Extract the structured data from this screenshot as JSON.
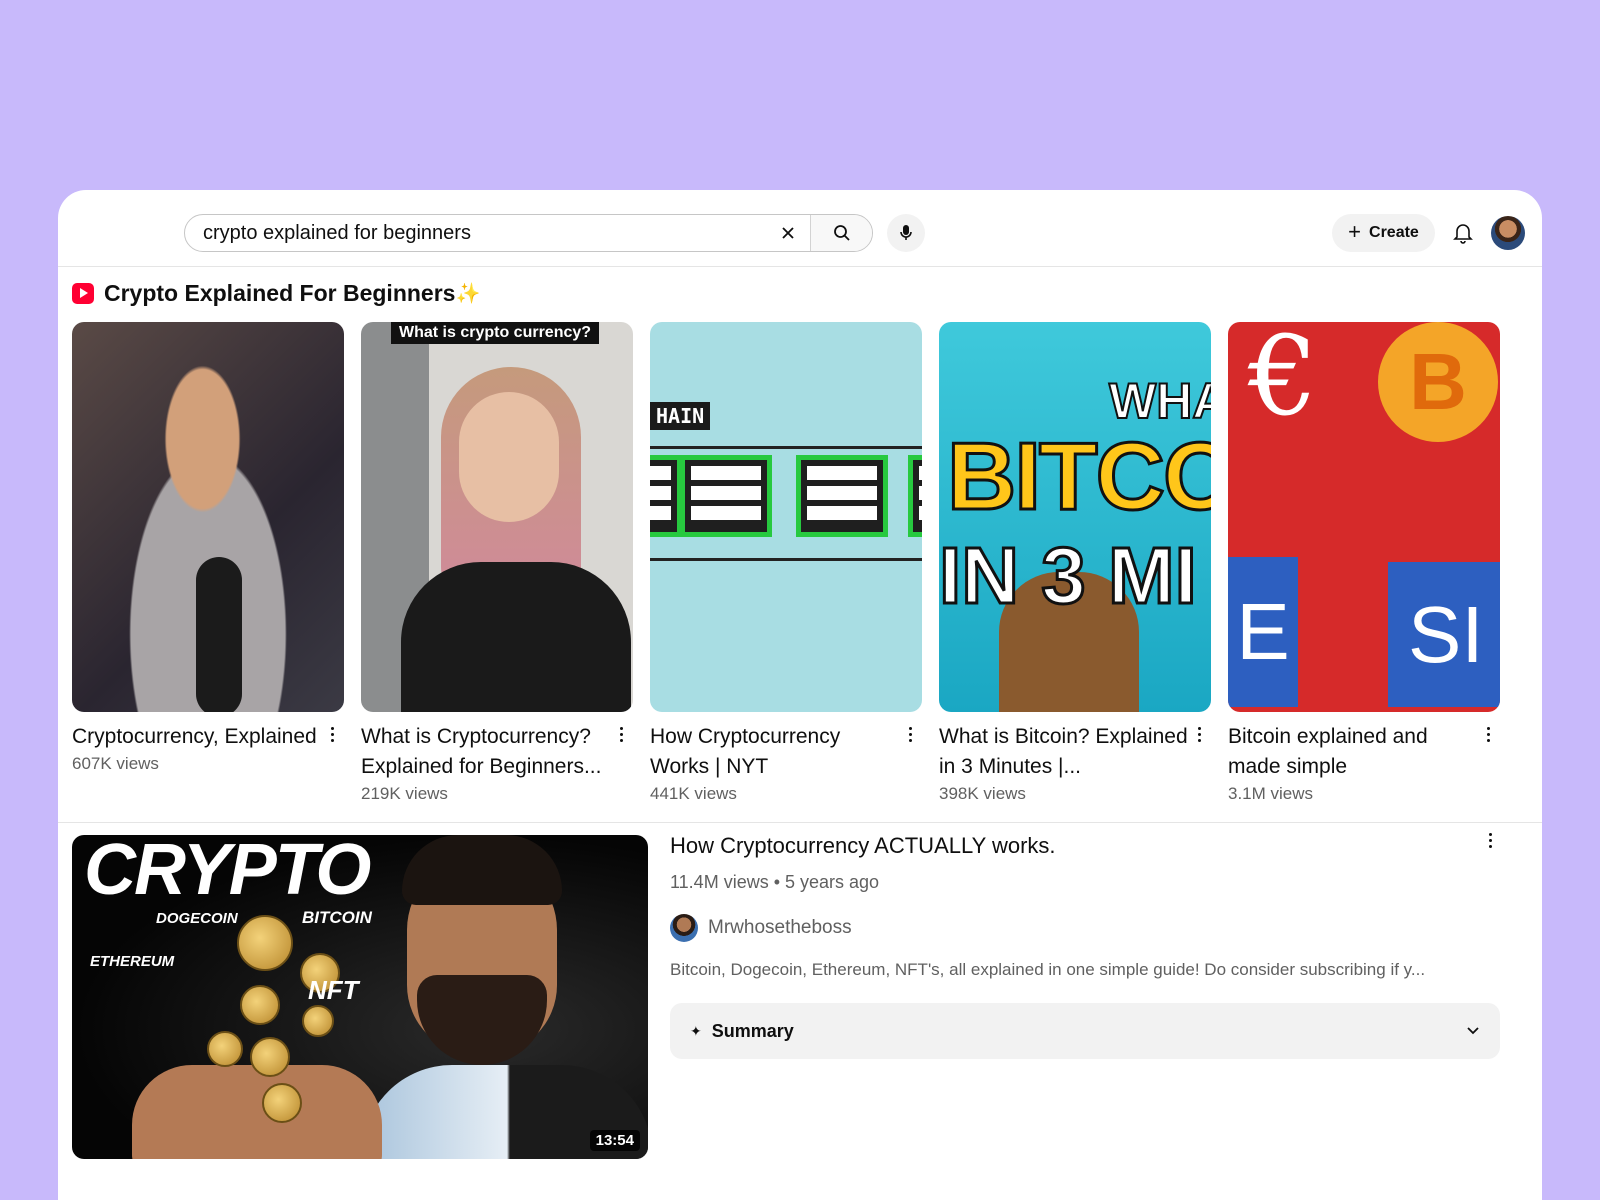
{
  "search": {
    "query": "crypto explained for beginners"
  },
  "header": {
    "create_label": "Create"
  },
  "shelf": {
    "title": "Crypto Explained For Beginners",
    "title_emoji": "✨",
    "items": [
      {
        "title": "Cryptocurrency, Explained",
        "views": "607K views"
      },
      {
        "title": "What is Cryptocurrency? Explained for Beginners...",
        "views": "219K views",
        "caption": "What is crypto currency?"
      },
      {
        "title": "How Cryptocurrency Works | NYT",
        "views": "441K views",
        "label": "HAIN"
      },
      {
        "title": "What is Bitcoin? Explained in 3 Minutes |...",
        "views": "398K views",
        "words": [
          "WHAT",
          "BITCO",
          "IN 3 MI"
        ]
      },
      {
        "title": "Bitcoin explained and made simple",
        "views": "3.1M views",
        "symbols": [
          "€",
          "B",
          "E",
          "SI"
        ]
      }
    ]
  },
  "video": {
    "title": "How Cryptocurrency ACTUALLY works.",
    "meta": "11.4M views • 5 years ago",
    "channel": "Mrwhosetheboss",
    "description": "Bitcoin, Dogecoin, Ethereum, NFT's, all explained in one simple guide! Do consider subscribing if y...",
    "duration": "13:54",
    "thumb_words": {
      "big": "CRYPTO",
      "dogecoin": "DOGECOIN",
      "bitcoin": "BITCOIN",
      "ethereum": "ETHEREUM",
      "nft": "NFT"
    },
    "summary_label": "Summary"
  },
  "colors": {
    "background": "#c8b9fb",
    "brand_red": "#ff0033"
  }
}
